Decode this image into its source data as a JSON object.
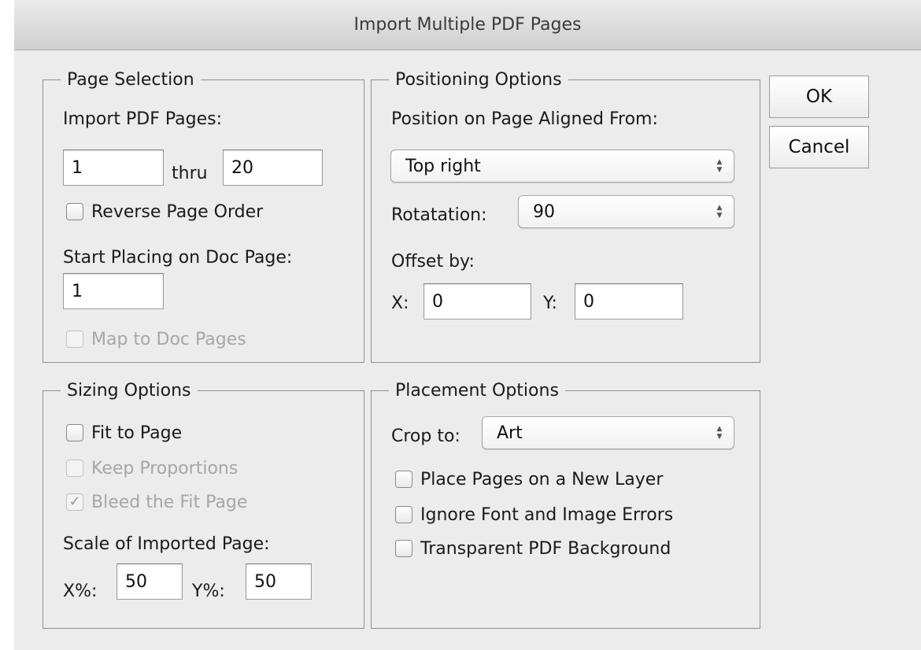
{
  "title": "Import Multiple PDF Pages",
  "page_selection": {
    "legend": "Page Selection",
    "import_label": "Import PDF Pages:",
    "from_value": "1",
    "thru_label": "thru",
    "to_value": "20",
    "reverse_label": "Reverse Page Order",
    "start_label": "Start Placing on Doc Page:",
    "start_value": "1",
    "map_label": "Map to Doc Pages"
  },
  "positioning": {
    "legend": "Positioning Options",
    "aligned_label": "Position on Page Aligned From:",
    "aligned_value": "Top right",
    "rotation_label": "Rotatation:",
    "rotation_value": "90",
    "offset_label": "Offset by:",
    "x_label": "X:",
    "x_value": "0",
    "y_label": "Y:",
    "y_value": "0"
  },
  "sizing": {
    "legend": "Sizing Options",
    "fit_label": "Fit to Page",
    "keep_label": "Keep Proportions",
    "bleed_label": "Bleed the Fit Page",
    "scale_label": "Scale of Imported Page:",
    "xpct_label": "X%:",
    "xpct_value": "50",
    "ypct_label": "Y%:",
    "ypct_value": "50"
  },
  "placement": {
    "legend": "Placement Options",
    "crop_label": "Crop to:",
    "crop_value": "Art",
    "new_layer_label": "Place Pages on a New Layer",
    "ignore_label": "Ignore Font and Image Errors",
    "transparent_label": "Transparent PDF Background"
  },
  "buttons": {
    "ok": "OK",
    "cancel": "Cancel"
  },
  "checkmark_glyph": "✓"
}
